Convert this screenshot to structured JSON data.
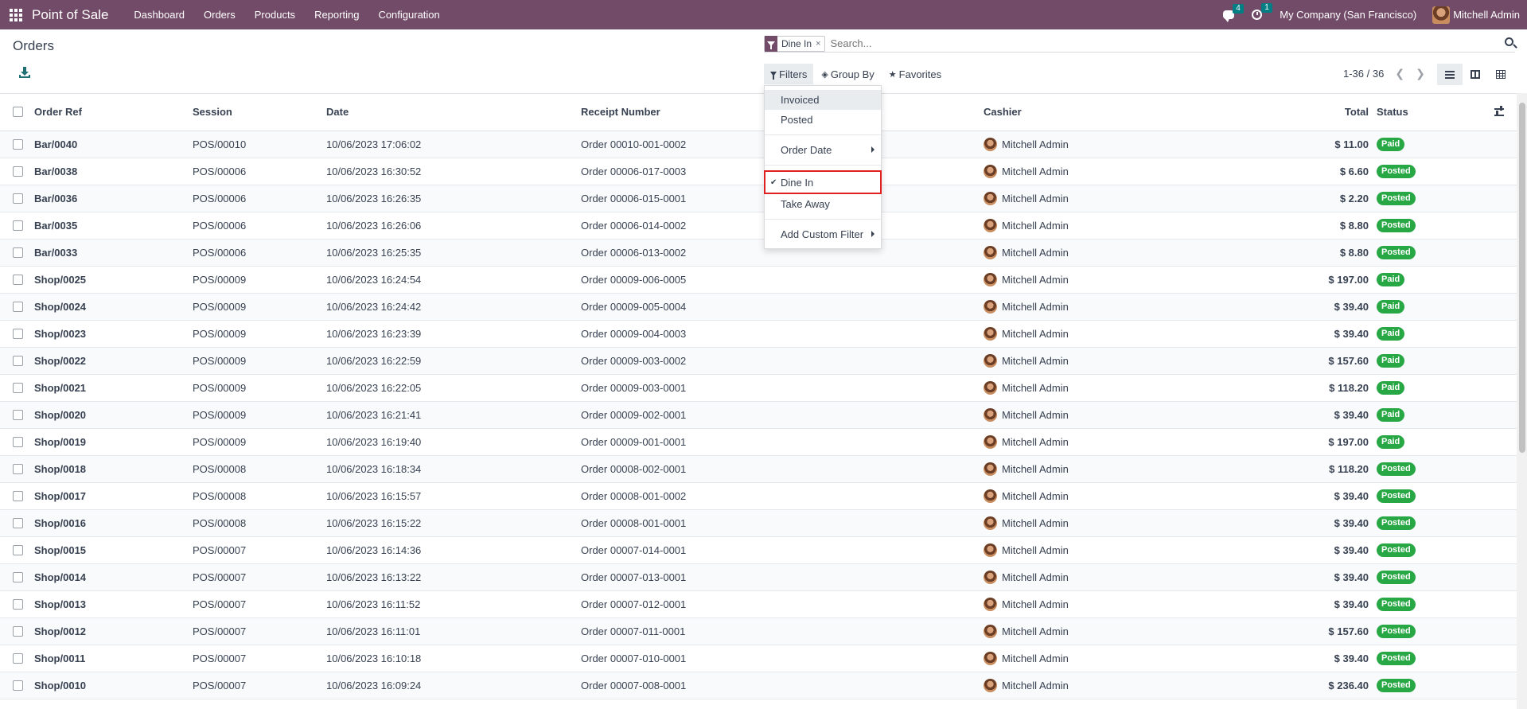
{
  "navbar": {
    "app_name": "Point of Sale",
    "menu": [
      "Dashboard",
      "Orders",
      "Products",
      "Reporting",
      "Configuration"
    ],
    "messages_count": "4",
    "activities_count": "1",
    "company": "My Company (San Francisco)",
    "user": "Mitchell Admin",
    "bar_color": "#714B67"
  },
  "control_panel": {
    "title": "Orders",
    "search": {
      "facet": "Dine In",
      "facet_remove": "×",
      "placeholder": "Search..."
    },
    "tools": {
      "filters": "Filters",
      "group_by": "Group By",
      "favorites": "Favorites"
    },
    "pager": "1-36 / 36"
  },
  "filters_dropdown": {
    "items": {
      "invoiced": "Invoiced",
      "posted": "Posted",
      "order_date": "Order Date",
      "dine_in": "Dine In",
      "take_away": "Take Away",
      "custom_filter": "Add Custom Filter"
    },
    "checked": "Dine In"
  },
  "table": {
    "columns": [
      "Order Ref",
      "Session",
      "Date",
      "Receipt Number",
      "Cashier",
      "Total",
      "Status"
    ],
    "rows": [
      {
        "ref": "Bar/0040",
        "session": "POS/00010",
        "date": "10/06/2023 17:06:02",
        "receipt": "Order 00010-001-0002",
        "cashier": "Mitchell Admin",
        "total": "$ 11.00",
        "status": "Paid"
      },
      {
        "ref": "Bar/0038",
        "session": "POS/00006",
        "date": "10/06/2023 16:30:52",
        "receipt": "Order 00006-017-0003",
        "cashier": "Mitchell Admin",
        "total": "$ 6.60",
        "status": "Posted"
      },
      {
        "ref": "Bar/0036",
        "session": "POS/00006",
        "date": "10/06/2023 16:26:35",
        "receipt": "Order 00006-015-0001",
        "cashier": "Mitchell Admin",
        "total": "$ 2.20",
        "status": "Posted"
      },
      {
        "ref": "Bar/0035",
        "session": "POS/00006",
        "date": "10/06/2023 16:26:06",
        "receipt": "Order 00006-014-0002",
        "cashier": "Mitchell Admin",
        "total": "$ 8.80",
        "status": "Posted"
      },
      {
        "ref": "Bar/0033",
        "session": "POS/00006",
        "date": "10/06/2023 16:25:35",
        "receipt": "Order 00006-013-0002",
        "cashier": "Mitchell Admin",
        "total": "$ 8.80",
        "status": "Posted"
      },
      {
        "ref": "Shop/0025",
        "session": "POS/00009",
        "date": "10/06/2023 16:24:54",
        "receipt": "Order 00009-006-0005",
        "cashier": "Mitchell Admin",
        "total": "$ 197.00",
        "status": "Paid"
      },
      {
        "ref": "Shop/0024",
        "session": "POS/00009",
        "date": "10/06/2023 16:24:42",
        "receipt": "Order 00009-005-0004",
        "cashier": "Mitchell Admin",
        "total": "$ 39.40",
        "status": "Paid"
      },
      {
        "ref": "Shop/0023",
        "session": "POS/00009",
        "date": "10/06/2023 16:23:39",
        "receipt": "Order 00009-004-0003",
        "cashier": "Mitchell Admin",
        "total": "$ 39.40",
        "status": "Paid"
      },
      {
        "ref": "Shop/0022",
        "session": "POS/00009",
        "date": "10/06/2023 16:22:59",
        "receipt": "Order 00009-003-0002",
        "cashier": "Mitchell Admin",
        "total": "$ 157.60",
        "status": "Paid"
      },
      {
        "ref": "Shop/0021",
        "session": "POS/00009",
        "date": "10/06/2023 16:22:05",
        "receipt": "Order 00009-003-0001",
        "cashier": "Mitchell Admin",
        "total": "$ 118.20",
        "status": "Paid"
      },
      {
        "ref": "Shop/0020",
        "session": "POS/00009",
        "date": "10/06/2023 16:21:41",
        "receipt": "Order 00009-002-0001",
        "cashier": "Mitchell Admin",
        "total": "$ 39.40",
        "status": "Paid"
      },
      {
        "ref": "Shop/0019",
        "session": "POS/00009",
        "date": "10/06/2023 16:19:40",
        "receipt": "Order 00009-001-0001",
        "cashier": "Mitchell Admin",
        "total": "$ 197.00",
        "status": "Paid"
      },
      {
        "ref": "Shop/0018",
        "session": "POS/00008",
        "date": "10/06/2023 16:18:34",
        "receipt": "Order 00008-002-0001",
        "cashier": "Mitchell Admin",
        "total": "$ 118.20",
        "status": "Posted"
      },
      {
        "ref": "Shop/0017",
        "session": "POS/00008",
        "date": "10/06/2023 16:15:57",
        "receipt": "Order 00008-001-0002",
        "cashier": "Mitchell Admin",
        "total": "$ 39.40",
        "status": "Posted"
      },
      {
        "ref": "Shop/0016",
        "session": "POS/00008",
        "date": "10/06/2023 16:15:22",
        "receipt": "Order 00008-001-0001",
        "cashier": "Mitchell Admin",
        "total": "$ 39.40",
        "status": "Posted"
      },
      {
        "ref": "Shop/0015",
        "session": "POS/00007",
        "date": "10/06/2023 16:14:36",
        "receipt": "Order 00007-014-0001",
        "cashier": "Mitchell Admin",
        "total": "$ 39.40",
        "status": "Posted"
      },
      {
        "ref": "Shop/0014",
        "session": "POS/00007",
        "date": "10/06/2023 16:13:22",
        "receipt": "Order 00007-013-0001",
        "cashier": "Mitchell Admin",
        "total": "$ 39.40",
        "status": "Posted"
      },
      {
        "ref": "Shop/0013",
        "session": "POS/00007",
        "date": "10/06/2023 16:11:52",
        "receipt": "Order 00007-012-0001",
        "cashier": "Mitchell Admin",
        "total": "$ 39.40",
        "status": "Posted"
      },
      {
        "ref": "Shop/0012",
        "session": "POS/00007",
        "date": "10/06/2023 16:11:01",
        "receipt": "Order 00007-011-0001",
        "cashier": "Mitchell Admin",
        "total": "$ 157.60",
        "status": "Posted"
      },
      {
        "ref": "Shop/0011",
        "session": "POS/00007",
        "date": "10/06/2023 16:10:18",
        "receipt": "Order 00007-010-0001",
        "cashier": "Mitchell Admin",
        "total": "$ 39.40",
        "status": "Posted"
      },
      {
        "ref": "Shop/0010",
        "session": "POS/00007",
        "date": "10/06/2023 16:09:24",
        "receipt": "Order 00007-008-0001",
        "cashier": "Mitchell Admin",
        "total": "$ 236.40",
        "status": "Posted"
      }
    ]
  },
  "colors": {
    "brand": "#714B67",
    "status_badge": "#28a745",
    "highlight_outline": "#e02020"
  }
}
